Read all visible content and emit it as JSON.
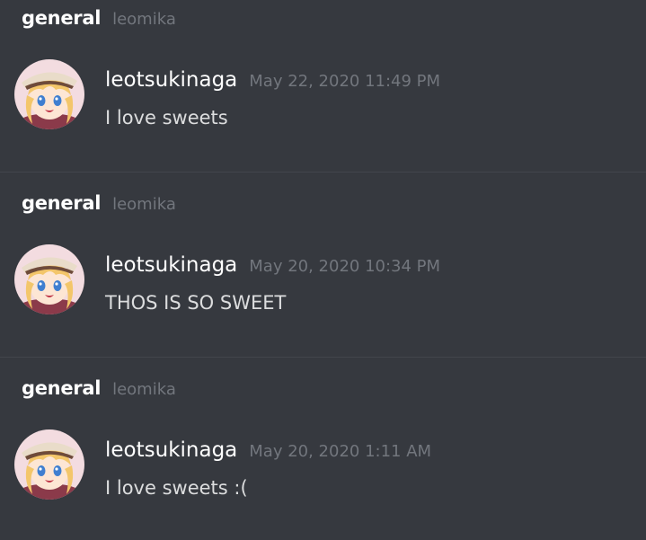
{
  "colors": {
    "background": "#36393f",
    "divider": "#42454c",
    "primary_text": "#ffffff",
    "muted_text": "#72767d",
    "message_text": "#dcddde"
  },
  "results": [
    {
      "channel": "general",
      "guild": "leomika",
      "message": {
        "avatar_icon": "user-avatar-icon",
        "username": "leotsukinaga",
        "timestamp": "May 22, 2020 11:49 PM",
        "content": "I love sweets"
      }
    },
    {
      "channel": "general",
      "guild": "leomika",
      "message": {
        "avatar_icon": "user-avatar-icon",
        "username": "leotsukinaga",
        "timestamp": "May 20, 2020 10:34 PM",
        "content": "THOS IS SO SWEET"
      }
    },
    {
      "channel": "general",
      "guild": "leomika",
      "message": {
        "avatar_icon": "user-avatar-icon",
        "username": "leotsukinaga",
        "timestamp": "May 20, 2020 1:11 AM",
        "content": "I love sweets :("
      }
    }
  ]
}
